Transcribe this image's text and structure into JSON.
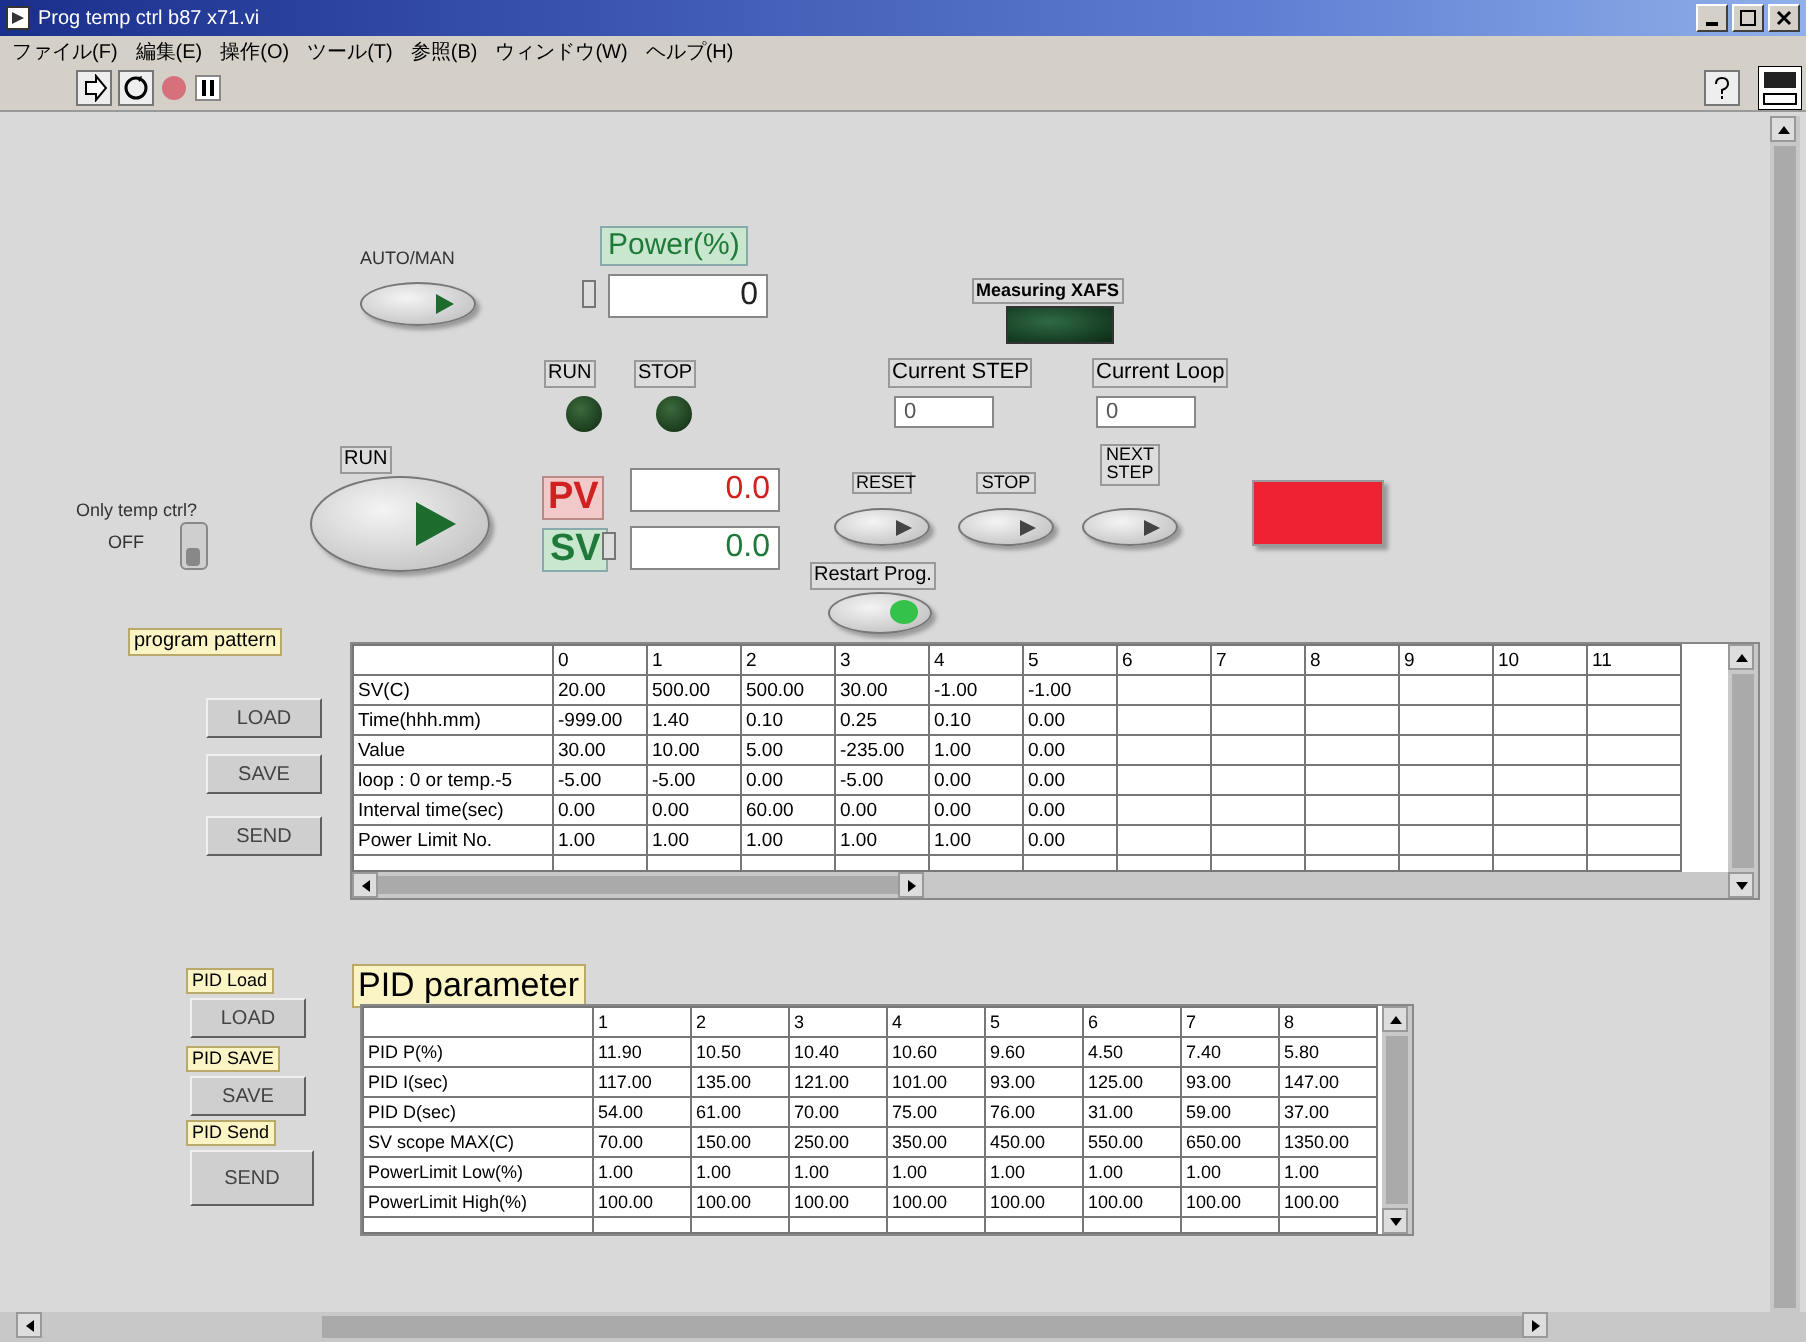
{
  "window": {
    "title": "Prog temp ctrl b87 x71.vi"
  },
  "menu": [
    "ファイル(F)",
    "編集(E)",
    "操作(O)",
    "ツール(T)",
    "参照(B)",
    "ウィンドウ(W)",
    "ヘルプ(H)"
  ],
  "panel": {
    "auto_man": {
      "label": "AUTO/MAN",
      "on": true
    },
    "power": {
      "label": "Power(%)",
      "value": "0"
    },
    "indicators": [
      {
        "label": "RUN",
        "on": false
      },
      {
        "label": "STOP",
        "on": false
      }
    ],
    "measuring": {
      "label": "Measuring XAFS",
      "on": false
    },
    "current_step": {
      "label": "Current STEP",
      "value": "0"
    },
    "current_loop": {
      "label": "Current Loop",
      "value": "0"
    },
    "only_temp": {
      "label": "Only temp ctrl?",
      "state_text": "OFF",
      "on": false
    },
    "run_button": {
      "label": "RUN",
      "on": true
    },
    "pv": {
      "label": "PV",
      "value": "0.0"
    },
    "sv": {
      "label": "SV",
      "value": "0.0"
    },
    "step_buttons": [
      {
        "label": "RESET",
        "on": false
      },
      {
        "label": "STOP",
        "on": false
      },
      {
        "label": "NEXT STEP",
        "on": false
      }
    ],
    "restart": {
      "label": "Restart Prog.",
      "on": true
    },
    "alarm_lamp": {
      "on": true
    }
  },
  "program": {
    "label": "program pattern",
    "buttons": [
      "LOAD",
      "SAVE",
      "SEND"
    ],
    "columns": [
      "0",
      "1",
      "2",
      "3",
      "4",
      "5",
      "6",
      "7",
      "8",
      "9",
      "10",
      "11"
    ],
    "rows": [
      {
        "header": "SV(C)",
        "cells": [
          "20.00",
          "500.00",
          "500.00",
          "30.00",
          "-1.00",
          "-1.00"
        ]
      },
      {
        "header": "Time(hhh.mm)",
        "cells": [
          "-999.00",
          "1.40",
          "0.10",
          "0.25",
          "0.10",
          "0.00"
        ]
      },
      {
        "header": "Value",
        "cells": [
          "30.00",
          "10.00",
          "5.00",
          "-235.00",
          "1.00",
          "0.00"
        ]
      },
      {
        "header": "loop : 0 or temp.-5",
        "cells": [
          "-5.00",
          "-5.00",
          "0.00",
          "-5.00",
          "0.00",
          "0.00"
        ]
      },
      {
        "header": "Interval time(sec)",
        "cells": [
          "0.00",
          "0.00",
          "60.00",
          "0.00",
          "0.00",
          "0.00"
        ]
      },
      {
        "header": "Power Limit No.",
        "cells": [
          "1.00",
          "1.00",
          "1.00",
          "1.00",
          "1.00",
          "0.00"
        ]
      }
    ]
  },
  "pid": {
    "label": "PID parameter",
    "buttons": [
      {
        "caption": "PID Load",
        "label": "LOAD"
      },
      {
        "caption": "PID SAVE",
        "label": "SAVE"
      },
      {
        "caption": "PID Send",
        "label": "SEND"
      }
    ],
    "columns": [
      "1",
      "2",
      "3",
      "4",
      "5",
      "6",
      "7",
      "8"
    ],
    "rows": [
      {
        "header": "PID P(%)",
        "cells": [
          "11.90",
          "10.50",
          "10.40",
          "10.60",
          "9.60",
          "4.50",
          "7.40",
          "5.80"
        ]
      },
      {
        "header": "PID I(sec)",
        "cells": [
          "117.00",
          "135.00",
          "121.00",
          "101.00",
          "93.00",
          "125.00",
          "93.00",
          "147.00"
        ]
      },
      {
        "header": "PID D(sec)",
        "cells": [
          "54.00",
          "61.00",
          "70.00",
          "75.00",
          "76.00",
          "31.00",
          "59.00",
          "37.00"
        ]
      },
      {
        "header": "SV scope MAX(C)",
        "cells": [
          "70.00",
          "150.00",
          "250.00",
          "350.00",
          "450.00",
          "550.00",
          "650.00",
          "1350.00"
        ]
      },
      {
        "header": "PowerLimit Low(%)",
        "cells": [
          "1.00",
          "1.00",
          "1.00",
          "1.00",
          "1.00",
          "1.00",
          "1.00",
          "1.00"
        ]
      },
      {
        "header": "PowerLimit High(%)",
        "cells": [
          "100.00",
          "100.00",
          "100.00",
          "100.00",
          "100.00",
          "100.00",
          "100.00",
          "100.00"
        ]
      }
    ]
  }
}
